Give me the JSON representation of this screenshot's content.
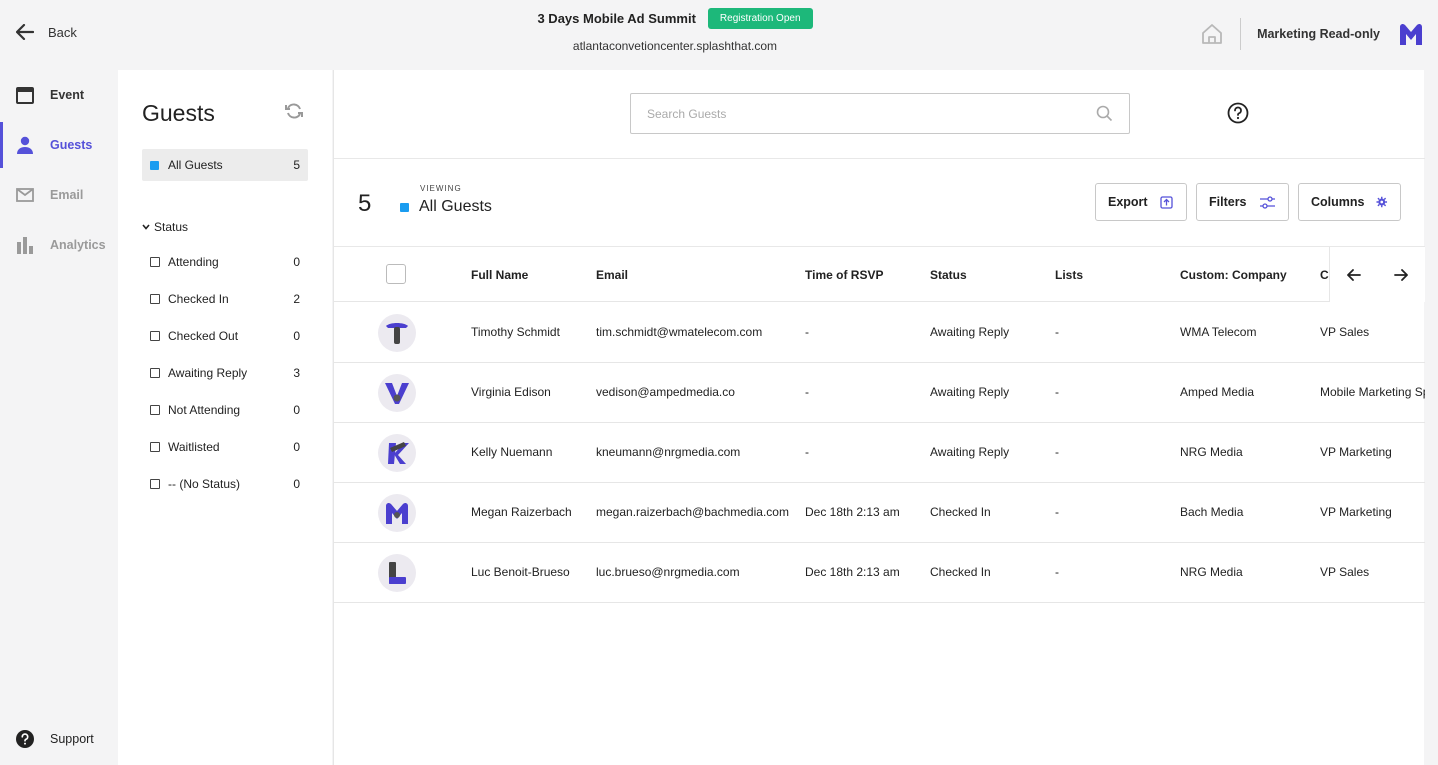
{
  "topbar": {
    "back_label": "Back",
    "event_title": "3 Days Mobile Ad Summit",
    "badge": "Registration Open",
    "event_url": "atlantaconvetioncenter.splashthat.com",
    "role": "Marketing Read-only"
  },
  "nav": {
    "items": [
      {
        "label": "Event",
        "icon": "calendar-icon"
      },
      {
        "label": "Guests",
        "icon": "person-icon"
      },
      {
        "label": "Email",
        "icon": "envelope-icon"
      },
      {
        "label": "Analytics",
        "icon": "bar-chart-icon"
      }
    ],
    "support_label": "Support"
  },
  "guests_panel": {
    "title": "Guests",
    "all_guests": {
      "label": "All Guests",
      "count": "5"
    },
    "status_heading": "Status",
    "statuses": [
      {
        "label": "Attending",
        "count": "0"
      },
      {
        "label": "Checked In",
        "count": "2"
      },
      {
        "label": "Checked Out",
        "count": "0"
      },
      {
        "label": "Awaiting Reply",
        "count": "3"
      },
      {
        "label": "Not Attending",
        "count": "0"
      },
      {
        "label": "Waitlisted",
        "count": "0"
      },
      {
        "label": "-- (No Status)",
        "count": "0"
      }
    ]
  },
  "main": {
    "search_placeholder": "Search Guests",
    "count": "5",
    "viewing_label": "VIEWING",
    "viewing_value": "All Guests",
    "buttons": {
      "export": "Export",
      "filters": "Filters",
      "columns": "Columns"
    }
  },
  "table": {
    "columns": [
      "Full Name",
      "Email",
      "Time of RSVP",
      "Status",
      "Lists",
      "Custom: Company",
      "Cu"
    ],
    "rows": [
      {
        "name": "Timothy Schmidt",
        "email": "tim.schmidt@wmatelecom.com",
        "rsvp": "-",
        "status": "Awaiting Reply",
        "lists": "-",
        "company": "WMA Telecom",
        "title": "VP Sales",
        "avatar": "T"
      },
      {
        "name": "Virginia Edison",
        "email": "vedison@ampedmedia.co",
        "rsvp": "-",
        "status": "Awaiting Reply",
        "lists": "-",
        "company": "Amped Media",
        "title": "Mobile Marketing Sp",
        "avatar": "V"
      },
      {
        "name": "Kelly Nuemann",
        "email": "kneumann@nrgmedia.com",
        "rsvp": "-",
        "status": "Awaiting Reply",
        "lists": "-",
        "company": "NRG Media",
        "title": "VP Marketing",
        "avatar": "K"
      },
      {
        "name": "Megan Raizerbach",
        "email": "megan.raizerbach@bachmedia.com",
        "rsvp": "Dec 18th 2:13 am",
        "status": "Checked In",
        "lists": "-",
        "company": "Bach Media",
        "title": "VP Marketing",
        "avatar": "M"
      },
      {
        "name": "Luc Benoit-Brueso",
        "email": "luc.brueso@nrgmedia.com",
        "rsvp": "Dec 18th 2:13 am",
        "status": "Checked In",
        "lists": "-",
        "company": "NRG Media",
        "title": "VP Sales",
        "avatar": "L"
      }
    ]
  },
  "colors": {
    "accent": "#5551d9",
    "badge_green": "#1db87a",
    "list_blue": "#1a9cf0"
  }
}
